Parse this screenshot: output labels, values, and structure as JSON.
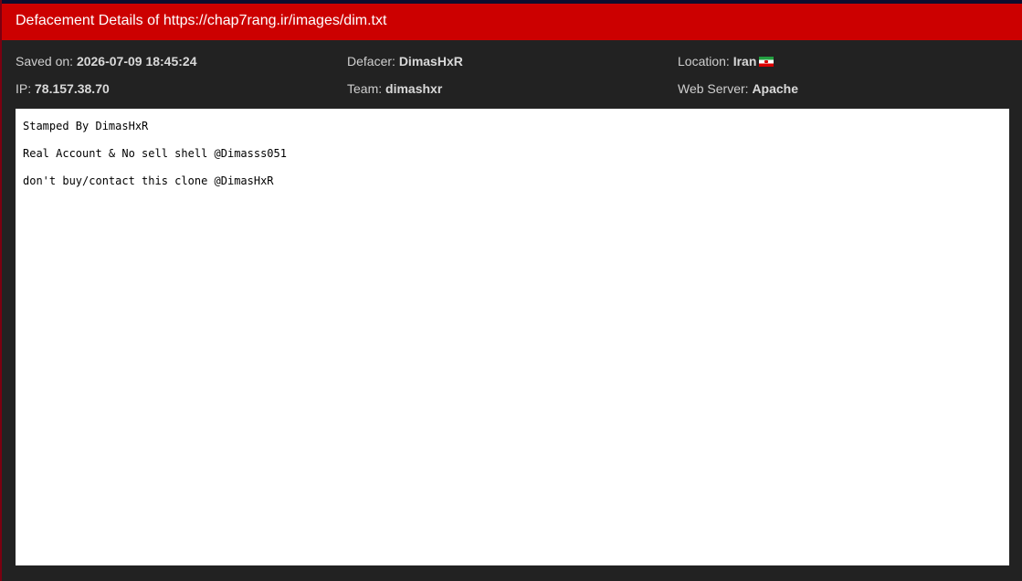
{
  "header": {
    "title": "Defacement Details of https://chap7rang.ir/images/dim.txt"
  },
  "meta": {
    "saved_on": {
      "label": "Saved on: ",
      "value": "2026-07-09 18:45:24"
    },
    "defacer": {
      "label": "Defacer: ",
      "value": "DimasHxR"
    },
    "location": {
      "label": "Location: ",
      "value": "Iran",
      "flag_icon": "iran-flag-icon"
    },
    "ip": {
      "label": "IP: ",
      "value": "78.157.38.70"
    },
    "team": {
      "label": "Team: ",
      "value": "dimashxr"
    },
    "web_server": {
      "label": "Web Server: ",
      "value": "Apache"
    }
  },
  "content": {
    "lines": [
      "Stamped By DimasHxR",
      "Real Account & No sell shell @Dimasss051",
      "don't buy/contact this clone @DimasHxR"
    ]
  },
  "colors": {
    "titlebar": "#cc0000",
    "panel": "#222222",
    "content_bg": "#ffffff"
  }
}
